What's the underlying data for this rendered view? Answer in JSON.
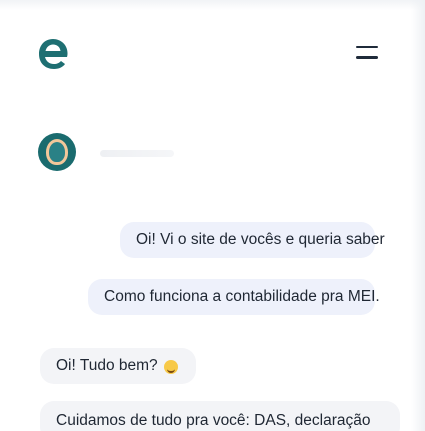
{
  "header": {
    "logo_icon": "brand-e-logo-icon",
    "brand_color": "#1e6f72",
    "menu_icon": "hamburger-menu-icon"
  },
  "agent": {
    "avatar_icon": "agent-avatar-icon",
    "avatar_color": "#1a6b6e"
  },
  "messages": [
    {
      "from": "user",
      "text": "Oi! Vi o site de vocês e queria saber"
    },
    {
      "from": "user",
      "text": "Como funciona a contabilidade pra MEI."
    },
    {
      "from": "agent",
      "text": "Oi! Tudo bem?",
      "emoji_icon": "smile-emoji-icon"
    },
    {
      "from": "agent",
      "text": "Cuidamos de tudo pra você: DAS, declaração"
    }
  ]
}
